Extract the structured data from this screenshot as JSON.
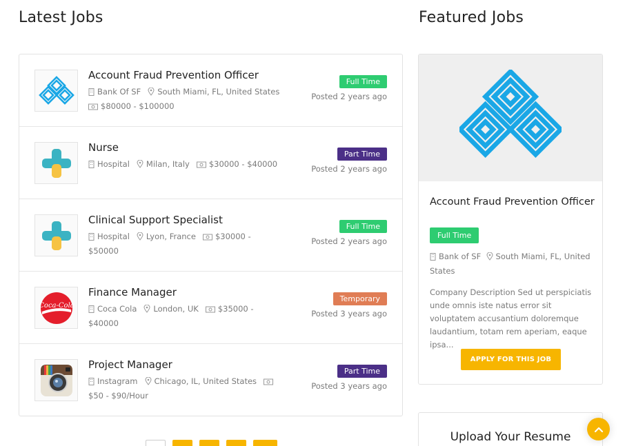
{
  "sections": {
    "latest_title": "Latest Jobs",
    "featured_title": "Featured Jobs"
  },
  "jobs": [
    {
      "title": "Account Fraud Prevention Officer",
      "company": "Bank Of SF",
      "location": "South Miami, FL, United States",
      "salary": "$80000 - $100000",
      "type": "Full Time",
      "posted": "Posted 2 years ago",
      "logo": "bank-logo"
    },
    {
      "title": "Nurse",
      "company": "Hospital",
      "location": "Milan, Italy",
      "salary": "$30000 - $40000",
      "type": "Part Time",
      "posted": "Posted 2 years ago",
      "logo": "hospital-cross-logo"
    },
    {
      "title": "Clinical Support Specialist",
      "company": "Hospital",
      "location": "Lyon, France",
      "salary": "$30000 - $50000",
      "type": "Full Time",
      "posted": "Posted 2 years ago",
      "logo": "hospital-cross-logo"
    },
    {
      "title": "Finance Manager",
      "company": "Coca Cola",
      "location": "London, UK",
      "salary": "$35000 - $40000",
      "type": "Temporary",
      "posted": "Posted 3 years ago",
      "logo": "coca-cola-logo"
    },
    {
      "title": "Project Manager",
      "company": "Instagram",
      "location": "Chicago, IL, United States",
      "salary": "$50 - $90/Hour",
      "type": "Part Time",
      "posted": "Posted 3 years ago",
      "logo": "instagram-logo"
    }
  ],
  "featured": {
    "title": "Account Fraud Prevention Officer",
    "type": "Full Time",
    "company": "Bank of SF",
    "location": "South Miami, FL, United States",
    "description": "Company Description Sed ut perspiciatis unde omnis iste natus error sit voluptatem accusantium doloremque laudantium, totam rem aperiam, eaque ipsa...",
    "apply_label": "APPLY FOR THIS JOB"
  },
  "upload": {
    "title": "Upload Your Resume"
  },
  "colors": {
    "full_time": "#2ecc71",
    "part_time": "#4b2f87",
    "temporary": "#e07d55",
    "accent": "#f7b500",
    "bank_blue": "#1aa7e6",
    "coca_cola_red": "#e41e2b"
  },
  "icons": [
    "building-icon",
    "map-pin-icon",
    "money-icon",
    "chevron-up-icon"
  ]
}
